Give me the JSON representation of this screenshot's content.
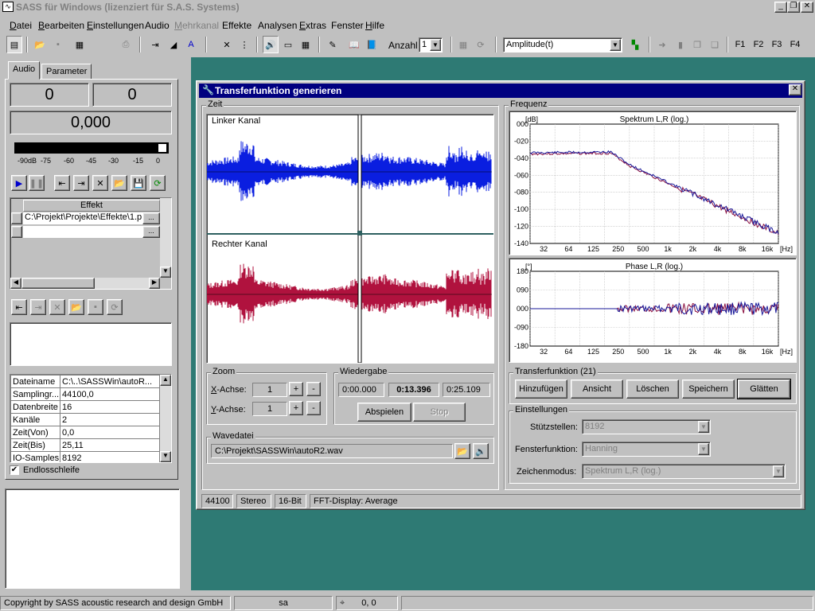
{
  "window": {
    "title": "SASS für Windows (lizenziert für S.A.S. Systems)",
    "app_icon": "waveform-icon"
  },
  "menu": [
    {
      "u": "D",
      "rest": "atei"
    },
    {
      "u": "B",
      "rest": "earbeiten"
    },
    {
      "u": "E",
      "rest": "instellungen"
    },
    {
      "u": "",
      "rest": "Audio"
    },
    {
      "u": "M",
      "rest": "ehrkanal",
      "disabled": true
    },
    {
      "u": "",
      "rest": "Effekte"
    },
    {
      "u": "",
      "rest": "Analysen"
    },
    {
      "u": "E",
      "rest": "xtras"
    },
    {
      "u": "",
      "rest": "Fenster"
    },
    {
      "u": "H",
      "rest": "ilfe"
    }
  ],
  "toolbar": {
    "anzahl_label": "Anzahl",
    "anzahl_value": "1",
    "analysis_value": "Amplitude(t)",
    "fkeys": [
      "F1",
      "F2",
      "F3",
      "F4"
    ]
  },
  "left": {
    "tabs": [
      "Audio",
      "Parameter"
    ],
    "counter_left": "0",
    "counter_right": "0",
    "time_display": "0,000",
    "meter_labels": [
      "-90dB",
      "-75",
      "-60",
      "-45",
      "-30",
      "-15",
      "0"
    ],
    "effects_header": "Effekt",
    "effects": [
      "C:\\Projekt\\Projekte\\Effekte\\1.p",
      ""
    ],
    "props": [
      [
        "Dateiname",
        "C:\\..\\SASSWin\\autoR..."
      ],
      [
        "Samplingr...",
        "44100,0"
      ],
      [
        "Datenbreite",
        "16"
      ],
      [
        "Kanäle",
        "2"
      ],
      [
        "Zeit(Von)",
        "0,0"
      ],
      [
        "Zeit(Bis)",
        "25,11"
      ],
      [
        "IO-Samples",
        "8192"
      ]
    ],
    "loop_label": "Endlosschleife",
    "loop_checked": true
  },
  "dialog": {
    "title": "Transferfunktion generieren",
    "zeit_group": "Zeit",
    "left_channel": "Linker Kanal",
    "right_channel": "Rechter Kanal",
    "zoom_group": "Zoom",
    "x_label": "X-Achse:",
    "y_label": "Y-Achse:",
    "x_value": "1",
    "y_value": "1",
    "wiedergabe_group": "Wiedergabe",
    "t_start": "0:00.000",
    "t_pos": "0:13.396",
    "t_end": "0:25.109",
    "play_label": "Abspielen",
    "stop_label": "Stop",
    "wave_group": "Wavedatei",
    "wave_path": "C:\\Projekt\\SASSWin\\autoR2.wav",
    "freq_group": "Frequenz",
    "spectrum": {
      "title": "Spektrum L,R (log.)",
      "unit": "[dB]",
      "y_ticks": [
        "000",
        "-020",
        "-040",
        "-060",
        "-080",
        "-100",
        "-120",
        "-140"
      ],
      "x_ticks": [
        "32",
        "64",
        "125",
        "250",
        "500",
        "1k",
        "2k",
        "4k",
        "8k",
        "16k"
      ],
      "x_unit": "[Hz]"
    },
    "phase": {
      "title": "Phase L,R (log.)",
      "unit": "[°]",
      "y_ticks": [
        "180",
        "090",
        "000",
        "-090",
        "-180"
      ],
      "x_ticks": [
        "32",
        "64",
        "125",
        "250",
        "500",
        "1k",
        "2k",
        "4k",
        "8k",
        "16k"
      ],
      "x_unit": "[Hz]"
    },
    "tf_group": "Transferfunktion (21)",
    "tf_buttons": [
      "Hinzufügen",
      "Ansicht",
      "Löschen",
      "Speichern",
      "Glätten"
    ],
    "settings_group": "Einstellungen",
    "stuetz_label": "Stützstellen:",
    "stuetz_value": "8192",
    "fenster_label": "Fensterfunktion:",
    "fenster_value": "Hanning",
    "zeichen_label": "Zeichenmodus:",
    "zeichen_value": "Spektrum L,R (log.)",
    "status": [
      "44100",
      "Stereo",
      "16-Bit",
      "FFT-Display: Average"
    ]
  },
  "statusbar": {
    "copyright": "Copyright by SASS acoustic research and design GmbH",
    "mode": "sa",
    "coords": "0, 0"
  },
  "colors": {
    "title_bg": "#000080",
    "mdi_bg": "#2e7a74",
    "left_wave": "#0a1ee0",
    "right_wave": "#b0123e",
    "spectrum_l": "#8a1040",
    "spectrum_r": "#1a1a9a"
  }
}
